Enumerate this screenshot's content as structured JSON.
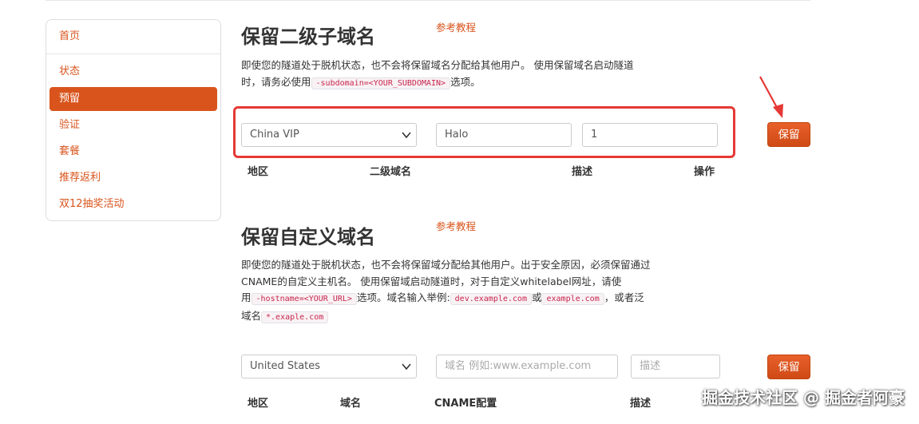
{
  "sidebar": {
    "items": [
      {
        "label": "首页"
      },
      {
        "label": "状态"
      },
      {
        "label": "预留"
      },
      {
        "label": "验证"
      },
      {
        "label": "套餐"
      },
      {
        "label": "推荐返利"
      },
      {
        "label": "双12抽奖活动"
      }
    ]
  },
  "subdomain": {
    "title": "保留二级子域名",
    "ref_link": "参考教程",
    "desc_part1": "即使您的隧道处于脱机状态，也不会将保留域名分配给其他用户。 使用保留域名启动隧道",
    "desc_part2": "时，请务必使用",
    "desc_code": "-subdomain=<YOUR_SUBDOMAIN>",
    "desc_part3": "选项。",
    "region_value": "China VIP",
    "subdomain_value": "Halo",
    "description_value": "1",
    "save_label": "保留",
    "headers": {
      "region": "地区",
      "subdomain": "二级域名",
      "description": "描述",
      "action": "操作"
    }
  },
  "custom": {
    "title": "保留自定义域名",
    "ref_link": "参考教程",
    "line1": "即使您的隧道处于脱机状态，也不会将保留域分配给其他用户。出于安全原因，必须保留通过",
    "line2": "CNAME的自定义主机名。 使用保留域启动隧道时，对于自定义whitelabel网址，请使",
    "line3_a": "用",
    "code_hostname": "-hostname=<YOUR_URL>",
    "line3_b": "选项。域名输入举例:",
    "code_ex1": "dev.example.com",
    "line3_c": "或",
    "code_ex2": "example.com",
    "line3_d": "，或者泛",
    "line4_a": "域名",
    "code_ex3": "*.exaple.com",
    "region_value": "United States",
    "domain_placeholder": "域名 例如:www.example.com",
    "description_placeholder": "描述",
    "save_label": "保留",
    "headers": {
      "region": "地区",
      "domain": "域名",
      "cname": "CNAME配置",
      "description": "描述"
    }
  },
  "watermark": "掘金技术社区 @ 掘金者阿豪",
  "colors": {
    "accent": "#d9541c",
    "highlight_border": "#e53935"
  }
}
